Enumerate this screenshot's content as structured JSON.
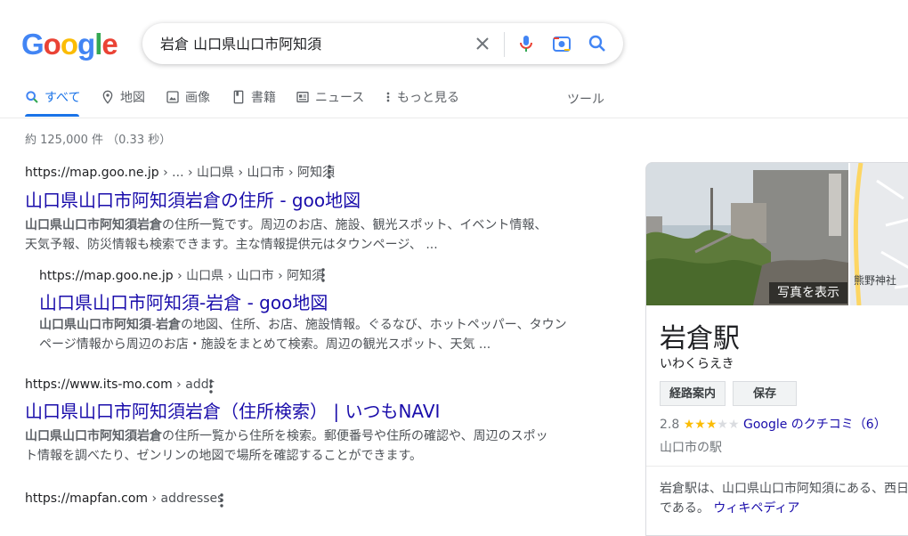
{
  "logo": {
    "text": "Google"
  },
  "search": {
    "query": "岩倉 山口県山口市阿知須"
  },
  "tabs": [
    {
      "label": "すべて",
      "icon": "search-icon",
      "active": true
    },
    {
      "label": "地図",
      "icon": "map-pin-icon"
    },
    {
      "label": "画像",
      "icon": "image-icon"
    },
    {
      "label": "書籍",
      "icon": "book-icon"
    },
    {
      "label": "ニュース",
      "icon": "news-icon"
    },
    {
      "label": "もっと見る",
      "icon": "more-vert-icon"
    }
  ],
  "tools_label": "ツール",
  "stats": "約 125,000 件 （0.33 秒）",
  "results": [
    {
      "domain": "https://map.goo.ne.jp",
      "path": " › ... › 山口県 › 山口市 › 阿知須",
      "title": "山口県山口市阿知須岩倉の住所 - goo地図",
      "snippet_bold": "山口県山口市阿知須岩倉",
      "snippet_line1": "の住所一覧です。周辺のお店、施設、観光スポット、イベント情報、",
      "snippet_line2": "天気予報、防災情報も検索できます。主な情報提供元はタウンページ、 ..."
    },
    {
      "domain": "https://map.goo.ne.jp",
      "path": " › 山口県 › 山口市 › 阿知須",
      "title": "山口県山口市阿知須-岩倉 - goo地図",
      "snippet_bold1": "山口県山口市阿知須",
      "snippet_mid": "-",
      "snippet_bold2": "岩倉",
      "snippet_line1": "の地図、住所、お店、施設情報。ぐるなび、ホットペッパー、タウン",
      "snippet_line2": "ページ情報から周辺のお店・施設をまとめて検索。周辺の観光スポット、天気 ..."
    },
    {
      "domain": "https://www.its-mo.com",
      "path": " › addr",
      "title": "山口県山口市阿知須岩倉（住所検索） | いつもNAVI",
      "snippet_bold": "山口県山口市阿知須岩倉",
      "snippet_line1": "の住所一覧から住所を検索。郵便番号や住所の確認や、周辺のスポッ",
      "snippet_line2": "ト情報を調べたり、ゼンリンの地図で場所を確認することができます。"
    },
    {
      "domain": "https://mapfan.com",
      "path": " › addresses"
    }
  ],
  "knowledge_panel": {
    "photo_button": "写真を表示",
    "map_label": "熊野神社",
    "title": "岩倉駅",
    "reading": "いわくらえき",
    "buttons": [
      "経路案内",
      "保存"
    ],
    "rating": "2.8",
    "stars_filled": 3,
    "stars_total": 5,
    "reviews_link": "Google のクチコミ（6）",
    "type": "山口市の駅",
    "description_line1": "岩倉駅は、山口県山口市阿知須にある、西日",
    "description_line2": "である。",
    "wiki_link": "ウィキペディア"
  },
  "colors": {
    "link": "#1a0dab",
    "accent": "#1a73e8",
    "star": "#fbbc04"
  }
}
